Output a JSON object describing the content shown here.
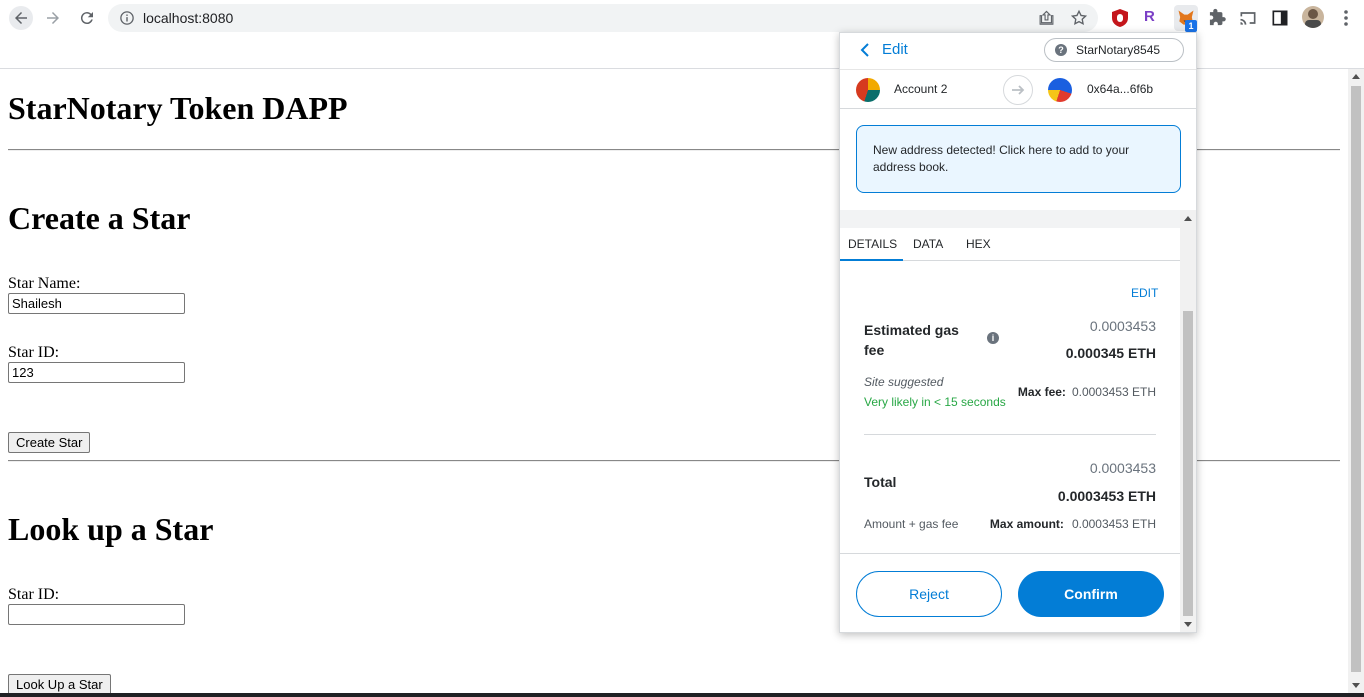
{
  "browser": {
    "url": "localhost:8080",
    "extension_badge": "1",
    "extension_r_label": "R"
  },
  "page": {
    "app_title": "StarNotary Token DAPP",
    "create_section": {
      "heading": "Create a Star",
      "star_name_label": "Star Name:",
      "star_name_value": "Shailesh",
      "star_id_label": "Star ID:",
      "star_id_value": "123",
      "button_label": "Create Star"
    },
    "lookup_section": {
      "heading": "Look up a Star",
      "star_id_label": "Star ID:",
      "star_id_value": "",
      "button_label": "Look Up a Star"
    }
  },
  "metamask": {
    "back_label": "Edit",
    "network": "StarNotary8545",
    "network_icon": "?",
    "from_account": "Account 2",
    "to_address": "0x64a...6f6b",
    "notice": "New address detected! Click here to add to your address book.",
    "tabs": [
      "DETAILS",
      "DATA",
      "HEX"
    ],
    "active_tab": "DETAILS",
    "edit_link": "EDIT",
    "gas": {
      "label": "Estimated gas fee",
      "secondary": "0.0003453",
      "primary": "0.000345 ETH",
      "site_suggested": "Site suggested",
      "likely": "Very likely in < 15 seconds",
      "max_fee_label": "Max fee:",
      "max_fee_value": "0.0003453 ETH"
    },
    "total": {
      "label": "Total",
      "secondary": "0.0003453",
      "primary": "0.0003453 ETH",
      "sub_label": "Amount + gas fee",
      "max_amount_label": "Max amount:",
      "max_amount_value": "0.0003453 ETH"
    },
    "reject_label": "Reject",
    "confirm_label": "Confirm",
    "colors": {
      "accent": "#037dd6",
      "success": "#28a745",
      "notice_bg": "#eaf6ff"
    }
  }
}
